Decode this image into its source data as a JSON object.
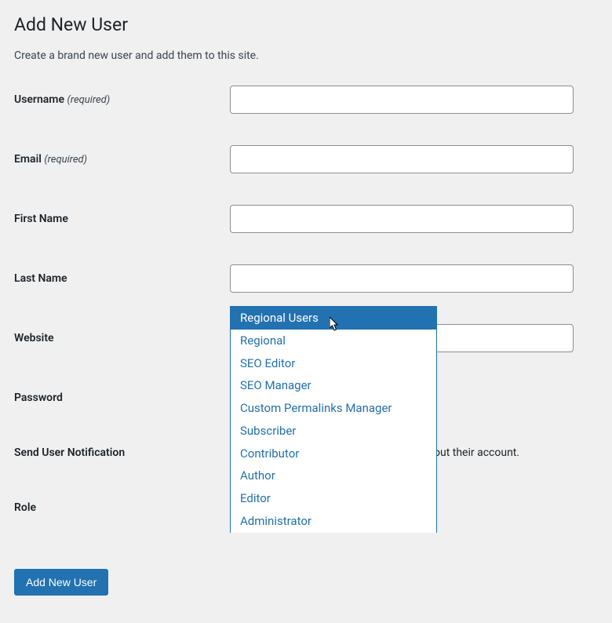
{
  "page_title": "Add New User",
  "subtitle": "Create a brand new user and add them to this site.",
  "fields": {
    "username": {
      "label": "Username",
      "required_text": "(required)",
      "value": ""
    },
    "email": {
      "label": "Email",
      "required_text": "(required)",
      "value": ""
    },
    "first_name": {
      "label": "First Name",
      "value": ""
    },
    "last_name": {
      "label": "Last Name",
      "value": ""
    },
    "website": {
      "label": "Website",
      "value": ""
    },
    "password": {
      "label": "Password"
    },
    "notification": {
      "label": "Send User Notification",
      "trailing_text": "out their account."
    },
    "role": {
      "label": "Role",
      "selected": "Subscriber"
    }
  },
  "role_options": [
    "Regional Users",
    "Regional",
    "SEO Editor",
    "SEO Manager",
    "Custom Permalinks Manager",
    "Subscriber",
    "Contributor",
    "Author",
    "Editor",
    "Administrator"
  ],
  "highlighted_option_index": 0,
  "submit_label": "Add New User"
}
